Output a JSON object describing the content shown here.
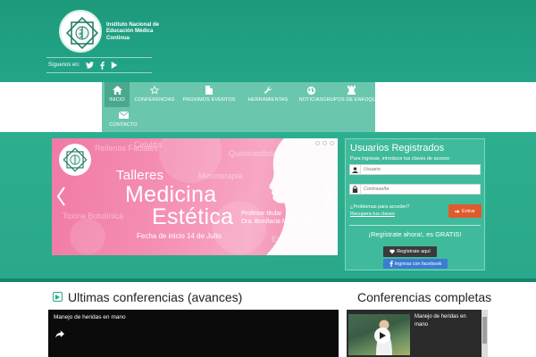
{
  "header": {
    "org_lines": [
      "Instituto Nacional de",
      "Educación Médica",
      "Continua"
    ],
    "follow_label": "Síguenos en:",
    "social_icons": [
      "twitter-icon",
      "facebook-icon",
      "youtube-icon"
    ]
  },
  "nav": {
    "items": [
      {
        "label": "INICIO",
        "icon": "home-icon",
        "active": true
      },
      {
        "label": "CONFERENCIAS",
        "icon": "star-icon"
      },
      {
        "label": "PROXIMOS EVENTOS",
        "icon": "document-icon"
      },
      {
        "label": "HERRAMIENTAS",
        "icon": "wrench-icon"
      },
      {
        "label": "NOTICIAS",
        "icon": "globe-icon"
      },
      {
        "label": "GRUPOS DE ENFOQUE",
        "icon": "chess-rook-icon"
      },
      {
        "label": "CONTACTO",
        "icon": "envelope-icon"
      }
    ]
  },
  "slider": {
    "ghost_words": [
      "Celulitis",
      "Rellenos Faciales",
      "Quimioexfoliación",
      "Mesoterapia",
      "Toxina Botulínica",
      "Escleroterapia"
    ],
    "line1": "Talleres",
    "line2": "Medicina",
    "line3": "Estética",
    "date": "Fecha de inicio 14 de Julio",
    "prof_role": "Profesor titular",
    "prof_name": "Dra. Bonifacia Matías Juan",
    "slide_count": 3,
    "active_slide": 1
  },
  "login": {
    "title": "Usuarios Registrados",
    "subtitle": "Para ingresar, introduce tus claves de acceso",
    "user_placeholder": "Usuario",
    "password_placeholder": "Contraseña",
    "problems_link": "¿Problemas para acceder?",
    "recover_link": "Recupera tus claves",
    "submit_label": "Entrar",
    "cta": "¡Regístrate ahora!, es GRATIS!",
    "register_label": "Regístrate aquí",
    "facebook_label": "Ingresa con facebook"
  },
  "sections": {
    "latest_title": "Ultimas conferencias (avances)",
    "complete_title": "Conferencias completas",
    "video_title": "Manejo de heridas en mano",
    "thumb_title": "Manejo de heridas en mano"
  },
  "colors": {
    "brand_teal": "#2aa88a",
    "nav_bg": "#6ac7ae",
    "submit_orange": "#e05a2b",
    "facebook_blue": "#3b7bd4"
  }
}
